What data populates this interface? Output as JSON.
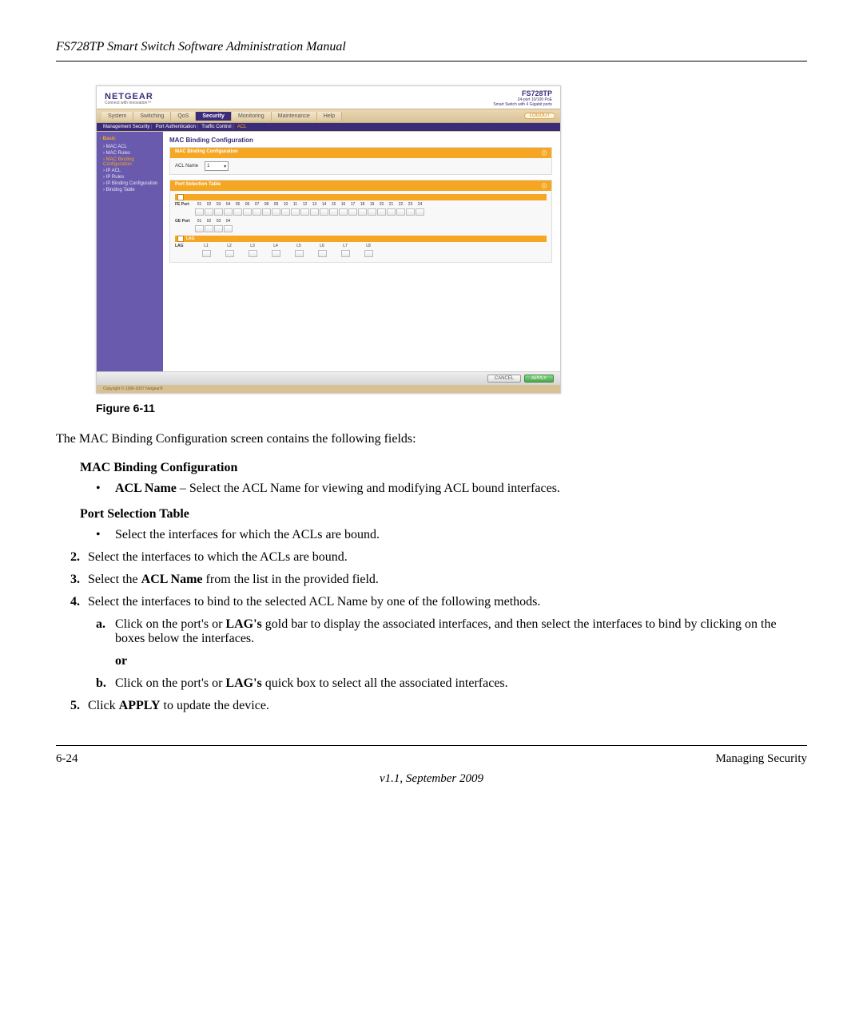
{
  "doc": {
    "header_title": "FS728TP Smart Switch Software Administration Manual",
    "figure_label": "Figure 6-11",
    "intro": "The MAC Binding Configuration screen contains the following fields:",
    "sec1_title": "MAC Binding Configuration",
    "sec1_bullet_bold": "ACL Name",
    "sec1_bullet_rest": " – Select the ACL Name for viewing and modifying ACL bound interfaces.",
    "sec2_title": "Port Selection Table",
    "sec2_bullet": "Select the interfaces for which the ACLs are bound.",
    "step2_num": "2.",
    "step2": "Select the interfaces to which the ACLs are bound.",
    "step3_num": "3.",
    "step3_a": "Select the ",
    "step3_bold": "ACL Name",
    "step3_b": " from the list in the provided field.",
    "step4_num": "4.",
    "step4": "Select the interfaces to bind to the selected ACL Name by one of the following methods.",
    "step4a_letter": "a.",
    "step4a_1": "Click on the port's or ",
    "step4a_bold": "LAG's",
    "step4a_2": " gold bar to display the associated interfaces, and then select the interfaces to bind by clicking on the boxes below the interfaces.",
    "or": "or",
    "step4b_letter": "b.",
    "step4b_1": "Click on the port's or ",
    "step4b_bold": "LAG's",
    "step4b_2": " quick box to select all the associated interfaces.",
    "step5_num": "5.",
    "step5_a": "Click ",
    "step5_bold": "APPLY",
    "step5_b": " to update the device.",
    "page_num": "6-24",
    "footer_section": "Managing Security",
    "version": "v1.1, September 2009"
  },
  "ui": {
    "brand": "NETGEAR",
    "brand_sub": "Connect with Innovation™",
    "model": "FS728TP",
    "model_sub1": "24-port 10/100 PoE",
    "model_sub2": "Smart Switch with 4 Gigabit ports",
    "tabs": [
      "System",
      "Switching",
      "QoS",
      "Security",
      "Monitoring",
      "Maintenance",
      "Help"
    ],
    "active_tab_index": 3,
    "logout": "LOGOUT",
    "subtabs": [
      "Management Security",
      "Port Authentication",
      "Traffic Control",
      "ACL"
    ],
    "active_subtab_index": 3,
    "sidebar_title": "Basic",
    "sidebar_items": [
      "MAC ACL",
      "MAC Rules",
      "MAC Binding Configuration",
      "IP ACL",
      "IP Rules",
      "IP Binding Configuration",
      "Binding Table"
    ],
    "sidebar_active_index": 2,
    "page_title": "MAC Binding Configuration",
    "panel1_title": "MAC Binding Configuration",
    "acl_label": "ACL Name",
    "acl_value": "1",
    "panel2_title": "Port Selection Table",
    "fe_label": "FE Port",
    "fe_ports": [
      "01",
      "02",
      "03",
      "04",
      "05",
      "06",
      "07",
      "08",
      "09",
      "10",
      "11",
      "12",
      "13",
      "14",
      "15",
      "16",
      "17",
      "18",
      "19",
      "20",
      "21",
      "22",
      "23",
      "24"
    ],
    "ge_label": "GE Port",
    "ge_ports": [
      "01",
      "02",
      "03",
      "04"
    ],
    "lag_bar_label": "LAG",
    "lag_label": "LAG",
    "lags": [
      "L1",
      "L2",
      "L3",
      "L4",
      "L5",
      "L6",
      "L7",
      "L8"
    ],
    "btn_cancel": "CANCEL",
    "btn_apply": "APPLY",
    "copyright": "Copyright © 1996-2007 Netgear®"
  }
}
